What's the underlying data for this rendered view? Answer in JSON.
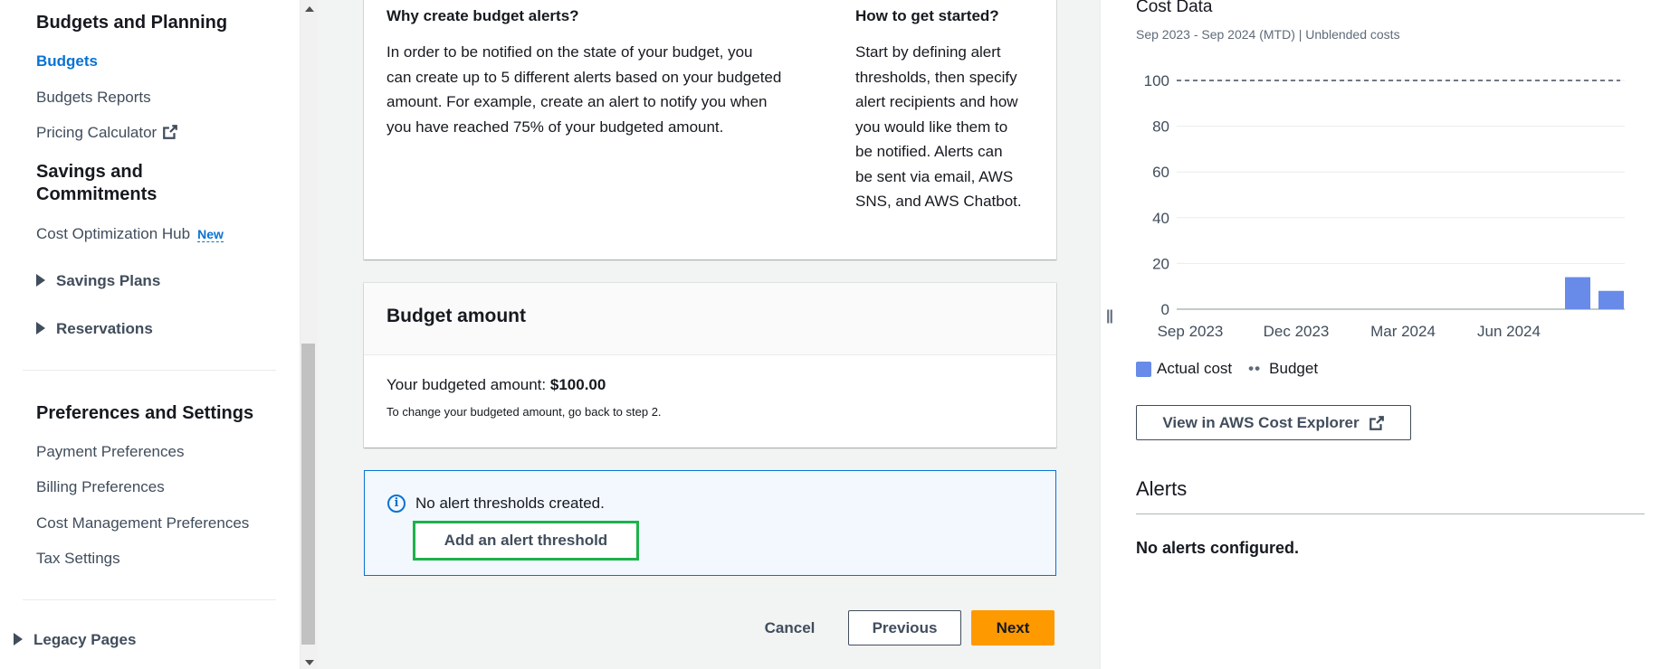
{
  "sidebar": {
    "section_budgets": "Budgets and Planning",
    "budgets": "Budgets",
    "budgets_reports": "Budgets Reports",
    "pricing_calculator": "Pricing Calculator",
    "section_savings_1": "Savings and",
    "section_savings_2": "Commitments",
    "cost_optimization_hub": "Cost Optimization Hub",
    "new_badge": "New",
    "savings_plans": "Savings Plans",
    "reservations": "Reservations",
    "section_prefs": "Preferences and Settings",
    "payment_preferences": "Payment Preferences",
    "billing_preferences": "Billing Preferences",
    "cost_management_preferences": "Cost Management Preferences",
    "tax_settings": "Tax Settings",
    "legacy_pages": "Legacy Pages"
  },
  "why": {
    "title": "Why create budget alerts?",
    "body_lines": [
      "In order to be notified on the state of your budget, you",
      "can create up to 5 different alerts based on your budgeted",
      "amount. For example, create an alert to notify you when",
      "you have reached 75% of your budgeted amount."
    ]
  },
  "how": {
    "title": "How to get started?",
    "body_lines": [
      "Start by defining alert",
      "thresholds, then specify",
      "alert recipients and how",
      "you would like them to",
      "be notified. Alerts can",
      "be sent via email, AWS",
      "SNS, and AWS Chatbot."
    ]
  },
  "budget_amount": {
    "title": "Budget amount",
    "label": "Your budgeted amount:",
    "value": "$100.00",
    "hint": "To change your budgeted amount, go back to step 2."
  },
  "alert_info": {
    "message": "No alert thresholds created.",
    "add_button": "Add an alert threshold"
  },
  "footer": {
    "cancel": "Cancel",
    "previous": "Previous",
    "next": "Next"
  },
  "cost_data": {
    "title": "Cost Data",
    "subtitle": "Sep 2023 - Sep 2024 (MTD) | Unblended costs",
    "legend_actual": "Actual cost",
    "legend_budget": "Budget",
    "explorer_button": "View in AWS Cost Explorer"
  },
  "alerts": {
    "title": "Alerts",
    "empty": "No alerts configured."
  },
  "colors": {
    "accent": "#0972d3",
    "primary_button": "#ff9900",
    "highlight_border": "#1db24a",
    "bar": "#688ae8"
  },
  "chart_data": {
    "type": "bar",
    "title": "Cost Data",
    "y_ticks": [
      0,
      20,
      40,
      60,
      80,
      100
    ],
    "x_ticks": [
      "Sep 2023",
      "Dec 2023",
      "Mar 2024",
      "Jun 2024"
    ],
    "ylim": [
      0,
      100
    ],
    "categories": [
      "Aug 2024",
      "Sep 2024"
    ],
    "series": [
      {
        "name": "Actual cost",
        "values": [
          14,
          8
        ]
      },
      {
        "name": "Budget",
        "values": [
          100,
          100
        ]
      }
    ],
    "grid": true,
    "legend_position": "bottom"
  }
}
